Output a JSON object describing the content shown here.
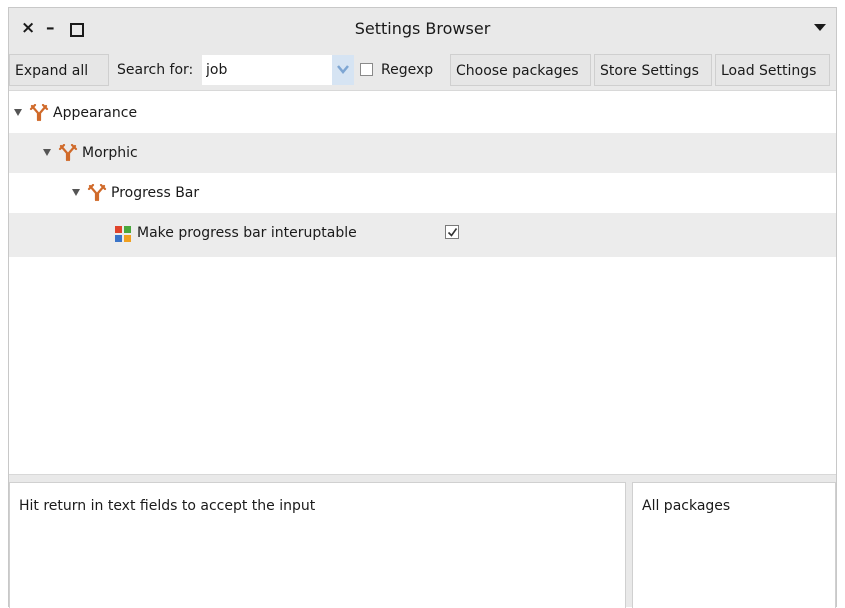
{
  "window": {
    "title": "Settings Browser",
    "close_glyph": "×",
    "minimize_glyph": "–"
  },
  "toolbar": {
    "expand_all": "Expand all",
    "search_label": "Search for:",
    "search_value": "job",
    "regexp_label": "Regexp",
    "regexp_checked": false,
    "choose_packages": "Choose packages",
    "store_settings": "Store Settings",
    "load_settings": "Load Settings"
  },
  "tree": {
    "nodes": [
      {
        "label": "Appearance",
        "expanded": true,
        "icon": "wrench-icon"
      },
      {
        "label": "Morphic",
        "expanded": true,
        "icon": "wrench-icon"
      },
      {
        "label": "Progress Bar",
        "expanded": true,
        "icon": "wrench-icon"
      },
      {
        "label": "Make progress bar interuptable",
        "icon": "setting-grid-icon",
        "checked": true
      }
    ]
  },
  "status": {
    "message": "Hit return in text fields to accept the input",
    "packages": "All packages"
  },
  "colors": {
    "window_bg": "#e9e9e9",
    "row_alt": "#ececec",
    "dropdown_accent": "#d6e4f3",
    "icon_red": "#e0442b",
    "icon_green": "#4aa83c",
    "icon_blue": "#3a74c8",
    "icon_orange": "#f0a020"
  }
}
